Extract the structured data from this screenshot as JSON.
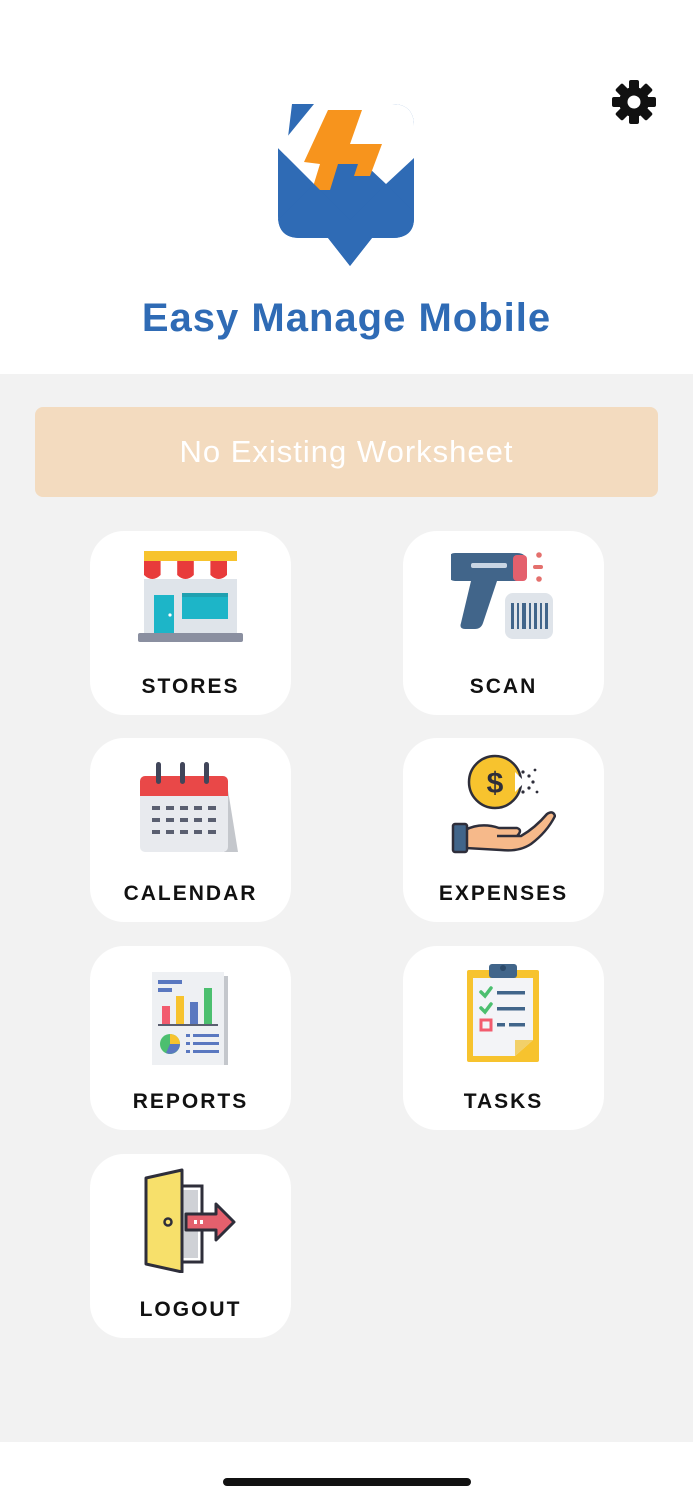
{
  "app": {
    "title": "Easy Manage Mobile"
  },
  "banner": {
    "text": "No Existing Worksheet"
  },
  "menu": {
    "stores": "STORES",
    "scan": "SCAN",
    "calendar": "CALENDAR",
    "expenses": "EXPENSES",
    "reports": "REPORTS",
    "tasks": "TASKS",
    "logout": "LOGOUT"
  },
  "icons": [
    "gear-icon",
    "app-logo",
    "store-icon",
    "barcode-scanner-icon",
    "calendar-icon",
    "money-hand-icon",
    "report-icon",
    "clipboard-icon",
    "door-exit-icon"
  ],
  "colors": {
    "brand_blue": "#2f6bb5",
    "brand_orange": "#f7941d",
    "banner_bg": "#f3dbbf"
  }
}
